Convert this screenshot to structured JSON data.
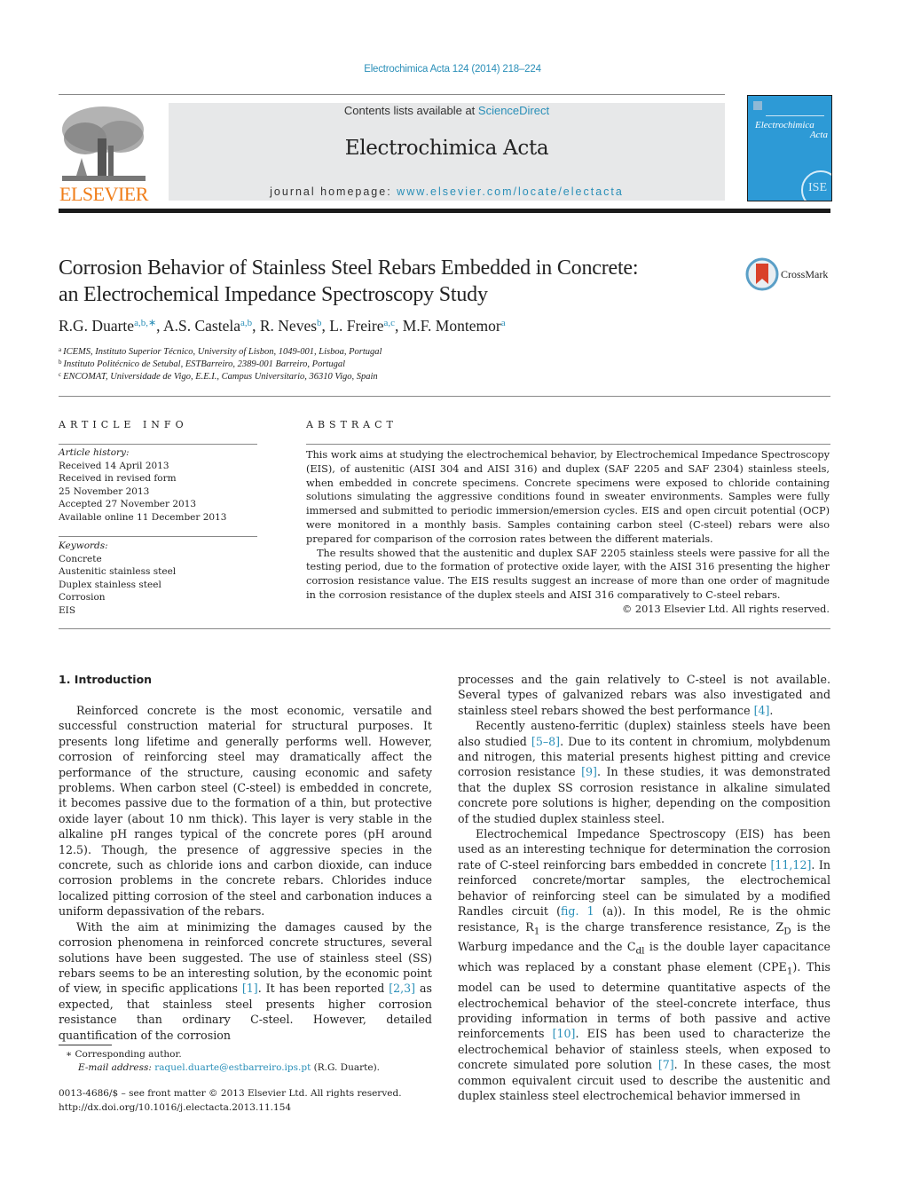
{
  "header": {
    "citation": "Electrochimica Acta 124 (2014) 218–224",
    "contents_prefix": "Contents lists available at ",
    "contents_link": "ScienceDirect",
    "journal_name": "Electrochimica Acta",
    "homepage_prefix": "journal homepage: ",
    "homepage_link": "www.elsevier.com/locate/electacta",
    "publisher_logo_text": "ELSEVIER",
    "cover_title_line1": "Electrochimica",
    "cover_title_line2": "Acta",
    "cover_badge": "ISE",
    "crossmark_label": "CrossMark"
  },
  "colors": {
    "link": "#2a8fb8",
    "elsevier_orange": "#f07d18",
    "band_gray": "#e7e8e9",
    "cover_blue": "#2d9ad6",
    "crossmark_red": "#d9412a"
  },
  "article": {
    "title_line1": "Corrosion Behavior of Stainless Steel Rebars Embedded in Concrete:",
    "title_line2": "an Electrochemical Impedance Spectroscopy Study",
    "authors": [
      {
        "name": "R.G. Duarte",
        "sup": "a,b,∗",
        "sep": ", "
      },
      {
        "name": "A.S. Castela",
        "sup": "a,b",
        "sep": ", "
      },
      {
        "name": "R. Neves",
        "sup": "b",
        "sep": ", "
      },
      {
        "name": "L. Freire",
        "sup": "a,c",
        "sep": ", "
      },
      {
        "name": "M.F. Montemor",
        "sup": "a",
        "sep": ""
      }
    ],
    "affiliations": [
      {
        "mark": "a",
        "text": "ICEMS, Instituto Superior Técnico, University of Lisbon, 1049-001, Lisboa, Portugal"
      },
      {
        "mark": "b",
        "text": "Instituto Politécnico de Setubal, ESTBarreiro, 2389-001 Barreiro, Portugal"
      },
      {
        "mark": "c",
        "text": "ENCOMAT, Universidade de Vigo, E.E.I., Campus Universitario, 36310 Vigo, Spain"
      }
    ]
  },
  "article_info": {
    "heading": "ARTICLE INFO",
    "history_label": "Article history:",
    "history": [
      "Received 14 April 2013",
      "Received in revised form",
      "25 November 2013",
      "Accepted 27 November 2013",
      "Available online 11 December 2013"
    ],
    "keywords_label": "Keywords:",
    "keywords": [
      "Concrete",
      "Austenitic stainless steel",
      "Duplex stainless steel",
      "Corrosion",
      "EIS"
    ]
  },
  "abstract": {
    "heading": "ABSTRACT",
    "p1": "This work aims at studying the electrochemical behavior, by Electrochemical Impedance Spectroscopy (EIS), of austenitic (AISI 304 and AISI 316) and duplex (SAF 2205 and SAF 2304) stainless steels, when embedded in concrete specimens. Concrete specimens were exposed to chloride containing solutions simulating the aggressive conditions found in sweater environments. Samples were fully immersed and submitted to periodic immersion/emersion cycles. EIS and open circuit potential (OCP) were monitored in a monthly basis. Samples containing carbon steel (C-steel) rebars were also prepared for comparison of the corrosion rates between the different materials.",
    "p2": "The results showed that the austenitic and duplex SAF 2205 stainless steels were passive for all the testing period, due to the formation of protective oxide layer, with the AISI 316 presenting the higher corrosion resistance value. The EIS results suggest an increase of more than one order of magnitude in the corrosion resistance of the duplex steels and AISI 316 comparatively to C-steel rebars.",
    "copyright": "© 2013 Elsevier Ltd. All rights reserved."
  },
  "intro": {
    "heading": "1.  Introduction",
    "left_p1": "Reinforced concrete is the most economic, versatile and successful construction material for structural purposes. It presents long lifetime and generally performs well. However, corrosion of reinforcing steel may dramatically affect the performance of the structure, causing economic and safety problems. When carbon steel (C-steel) is embedded in concrete, it becomes passive due to the formation of a thin, but protective oxide layer (about 10 nm thick). This layer is very stable in the alkaline pH ranges typical of the concrete pores (pH around 12.5). Though, the presence of aggressive species in the concrete, such as chloride ions and carbon dioxide, can induce corrosion problems in the concrete rebars. Chlorides induce localized pitting corrosion of the steel and carbonation induces a uniform depassivation of the rebars.",
    "left_p2_a": "With the aim at minimizing the damages caused by the corrosion phenomena in reinforced concrete structures, several solutions have been suggested. The use of stainless steel (SS) rebars seems to be an interesting solution, by the economic point of view, in specific applications ",
    "ref1": "[1]",
    "left_p2_b": ". It has been reported ",
    "ref23": "[2,3]",
    "left_p2_c": " as expected, that stainless steel presents higher corrosion resistance than ordinary C-steel. However, detailed quantification of the corrosion",
    "right_p1_a": "processes and the gain relatively to C-steel is not available. Several types of galvanized rebars was also investigated and stainless steel rebars showed the best performance ",
    "ref4": "[4]",
    "right_p1_b": ".",
    "right_p2_a": "Recently austeno-ferritic (duplex) stainless steels have been also studied ",
    "ref58": "[5–8]",
    "right_p2_b": ". Due to its content in chromium, molybdenum and nitrogen, this material presents highest pitting and crevice corrosion resistance ",
    "ref9": "[9]",
    "right_p2_c": ". In these studies, it was demonstrated that the duplex SS corrosion resistance in alkaline simulated concrete pore solutions is higher, depending on the composition of the studied duplex stainless steel.",
    "right_p3_a": "Electrochemical Impedance Spectroscopy (EIS) has been used as an interesting technique for determination the corrosion rate of C-steel reinforcing bars embedded in concrete ",
    "ref1112": "[11,12]",
    "right_p3_b": ". In reinforced concrete/mortar samples, the electrochemical behavior of reinforcing steel can be simulated by a modified Randles circuit (",
    "fig1": "fig. 1",
    "right_p3_c": " (a)). In this model, Re is the ohmic resistance, R",
    "sub1": "1",
    "right_p3_d": " is the charge transference resistance, Z",
    "subD": "D",
    "right_p3_e": " is the Warburg impedance and the C",
    "subdl": "dl",
    "right_p3_f": " is the double layer capacitance which was replaced by a constant phase element (CPE",
    "sub1b": "1",
    "right_p3_g": "). This model can be used to determine quantitative aspects of the electrochemical behavior of the steel-concrete interface, thus providing information in terms of both passive and active reinforcements ",
    "ref10": "[10]",
    "right_p3_h": ". EIS has been used to characterize the electrochemical behavior of stainless steels, when exposed to concrete simulated pore solution ",
    "ref7": "[7]",
    "right_p3_i": ". In these cases, the most common equivalent circuit used to describe the austenitic and duplex stainless steel electrochemical behavior immersed in"
  },
  "footnotes": {
    "corresponding": "∗  Corresponding author.",
    "email_label": "E-mail address: ",
    "email": "raquel.duarte@estbarreiro.ips.pt",
    "email_suffix": " (R.G. Duarte).",
    "front_matter": "0013-4686/$ – see front matter © 2013 Elsevier Ltd. All rights reserved.",
    "doi": "http://dx.doi.org/10.1016/j.electacta.2013.11.154"
  }
}
